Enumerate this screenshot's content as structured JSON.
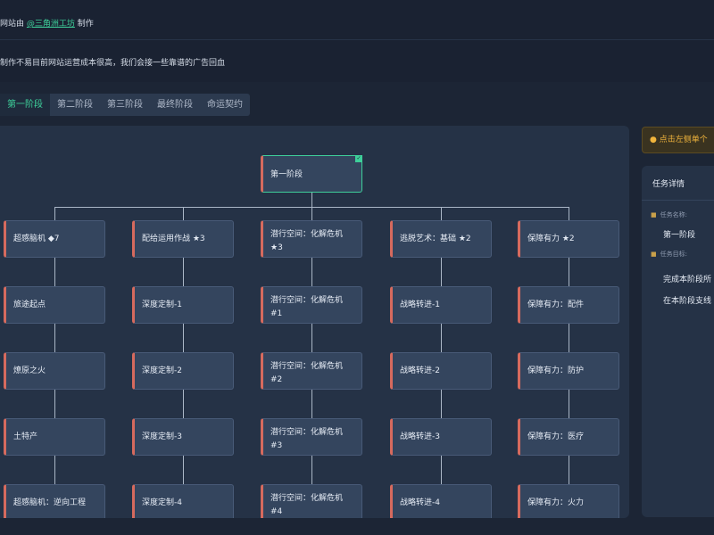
{
  "header": {
    "line1_prefix": "网站由",
    "line1_link": "@三角洲工坊",
    "line1_suffix": "制作",
    "line2": "制作不易目前网站运营成本很高，我们会接一些靠谱的广告回血"
  },
  "tabs": [
    {
      "label": "第一阶段",
      "active": true
    },
    {
      "label": "第二阶段",
      "active": false
    },
    {
      "label": "第三阶段",
      "active": false
    },
    {
      "label": "最终阶段",
      "active": false
    },
    {
      "label": "命运契约",
      "active": false
    }
  ],
  "tree": {
    "root": "第一阶段",
    "columns": [
      [
        "超感脑机 ◆7",
        "旅途起点",
        "燎原之火",
        "土特产",
        "超感脑机：逆向工程"
      ],
      [
        "配给运用作战 ★3",
        "深度定制-1",
        "深度定制-2",
        "深度定制-3",
        "深度定制-4"
      ],
      [
        [
          "潜行空间：化解危机",
          "★3"
        ],
        [
          "潜行空间：化解危机",
          "#1"
        ],
        [
          "潜行空间：化解危机",
          "#2"
        ],
        [
          "潜行空间：化解危机",
          "#3"
        ],
        [
          "潜行空间：化解危机",
          "#4"
        ]
      ],
      [
        "逃脱艺术：基础 ★2",
        "战略转进-1",
        "战略转进-2",
        "战略转进-3",
        "战略转进-4"
      ],
      [
        "保障有力 ★2",
        "保障有力：配件",
        "保障有力：防护",
        "保障有力：医疗",
        "保障有力：火力"
      ]
    ]
  },
  "hint": {
    "text": "点击左侧单个"
  },
  "detail": {
    "title": "任务详情",
    "name_label": "任务名称:",
    "name_value": "第一阶段",
    "goal_label": "任务目标:",
    "goal_line1": "完成本阶段所",
    "goal_line2": "在本阶段支线"
  },
  "colors": {
    "accent": "#3ecf9a",
    "node_stripe": "#d66a5e",
    "warning": "#f0b43c"
  },
  "icons": {
    "check": "check-icon",
    "info": "info-icon",
    "name": "home-icon",
    "goal": "doc-icon"
  }
}
